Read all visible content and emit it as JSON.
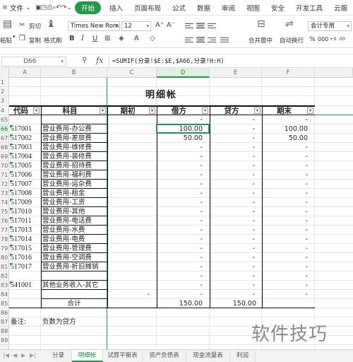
{
  "menu": {
    "file": "文件",
    "tabs": [
      "开始",
      "插入",
      "页面布局",
      "公式",
      "数据",
      "审阅",
      "视图",
      "安全",
      "开发工具",
      "云服"
    ],
    "active_tab": "开始"
  },
  "ribbon": {
    "paste": "粘贴",
    "cut": "剪切",
    "copy": "复制",
    "format_painter": "格式刷",
    "font_name": "Times New Roma",
    "font_size": "12",
    "merge_center": "合并居中",
    "wrap_text": "自动换行",
    "number_format": "会计专用",
    "percent": "%",
    "thousands": "000",
    "inc_decimal": "+0 .00",
    "dec_decimal": ".00 +0"
  },
  "formula_bar": {
    "name_box": "D66",
    "formula": "=SUMIF(分录!$E:$E,$A66,分录!H:H)"
  },
  "columns": [
    "A",
    "B",
    "C",
    "D",
    "E",
    "F"
  ],
  "selected_column": "D",
  "row_numbers": [
    "1",
    "2",
    "3",
    "4",
    "65",
    "66",
    "67",
    "68",
    "69",
    "70",
    "71",
    "72",
    "73",
    "74",
    "75",
    "76",
    "77",
    "78",
    "79",
    "80",
    "81",
    "82",
    "83",
    "84",
    "85",
    "86",
    "87",
    "88",
    "89"
  ],
  "selected_row": "66",
  "sheet": {
    "title": "明细帐",
    "headers": [
      "代码",
      "科目",
      "期初",
      "借方",
      "贷方",
      "期末"
    ],
    "rows": [
      {
        "code": "",
        "subject": "",
        "opening": "",
        "debit": "-",
        "credit": "-",
        "closing": "-"
      },
      {
        "code": "517001",
        "subject": "营业费用-办公费",
        "opening": "",
        "debit": "100.00",
        "credit": "-",
        "closing": "100.00"
      },
      {
        "code": "517002",
        "subject": "营业费用-差旅费",
        "opening": "",
        "debit": "50.00",
        "credit": "-",
        "closing": "50.00"
      },
      {
        "code": "517003",
        "subject": "营业费用-维修费",
        "opening": "",
        "debit": "-",
        "credit": "-",
        "closing": "-"
      },
      {
        "code": "517004",
        "subject": "营业费用-装修费",
        "opening": "",
        "debit": "-",
        "credit": "-",
        "closing": "-"
      },
      {
        "code": "517005",
        "subject": "营业费用-招待费",
        "opening": "",
        "debit": "-",
        "credit": "-",
        "closing": "-"
      },
      {
        "code": "517006",
        "subject": "营业费用-福利费",
        "opening": "",
        "debit": "-",
        "credit": "-",
        "closing": "-"
      },
      {
        "code": "517007",
        "subject": "营业费用-运杂费",
        "opening": "",
        "debit": "-",
        "credit": "-",
        "closing": "-"
      },
      {
        "code": "517008",
        "subject": "营业费用-租金",
        "opening": "",
        "debit": "-",
        "credit": "-",
        "closing": "-"
      },
      {
        "code": "517009",
        "subject": "营业费用-工资",
        "opening": "",
        "debit": "-",
        "credit": "-",
        "closing": "-"
      },
      {
        "code": "517010",
        "subject": "营业费用-其他",
        "opening": "",
        "debit": "-",
        "credit": "-",
        "closing": "-"
      },
      {
        "code": "517011",
        "subject": "营业费用-电话费",
        "opening": "",
        "debit": "-",
        "credit": "-",
        "closing": "-"
      },
      {
        "code": "517013",
        "subject": "营业费用-水费",
        "opening": "",
        "debit": "-",
        "credit": "-",
        "closing": "-"
      },
      {
        "code": "517014",
        "subject": "营业费用-电费",
        "opening": "",
        "debit": "-",
        "credit": "-",
        "closing": "-"
      },
      {
        "code": "517015",
        "subject": "营业费用-管理费",
        "opening": "",
        "debit": "-",
        "credit": "-",
        "closing": "-"
      },
      {
        "code": "517016",
        "subject": "营业费用-空调费",
        "opening": "",
        "debit": "-",
        "credit": "-",
        "closing": "-"
      },
      {
        "code": "517017",
        "subject": "营业费用-折旧摊销",
        "opening": "",
        "debit": "-",
        "credit": "-",
        "closing": "-"
      },
      {
        "code": "",
        "subject": "",
        "opening": "",
        "debit": "-",
        "credit": "-",
        "closing": "-"
      },
      {
        "code": "541001",
        "subject": "其他业务收入-其它",
        "opening": "",
        "debit": "-",
        "credit": "-",
        "closing": "-"
      },
      {
        "code": "",
        "subject": "",
        "opening": "-",
        "debit": "-",
        "credit": "-",
        "closing": "-"
      }
    ],
    "total_label": "合计",
    "total_debit": "150.00",
    "total_credit": "150.00",
    "note_label": "备注:",
    "note_text": "负数为贷方"
  },
  "sheet_tabs": [
    "分录",
    "明细帐",
    "试算平衡表",
    "资产负债表",
    "现金流量表",
    "利润"
  ],
  "active_sheet": "明细帐",
  "watermark": "软件技巧",
  "colors": {
    "accent": "#1f9a4b"
  }
}
